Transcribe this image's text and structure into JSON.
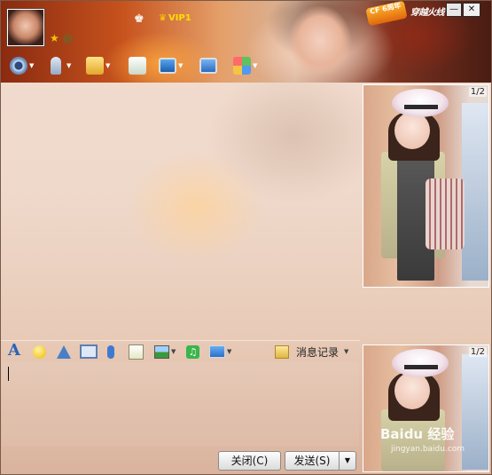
{
  "header": {
    "vip_label": "VIP1",
    "skin_badge": "CF 6周年",
    "skin_caption": "穿越火线",
    "minimize_glyph": "—",
    "close_glyph": "✕",
    "icons": [
      "avatar",
      "star-icon",
      "qq-status-icon",
      "penguin-icon",
      "crown-icon"
    ]
  },
  "toolbar": {
    "items": [
      {
        "name": "video-chat-icon",
        "has_menu": true
      },
      {
        "name": "voice-chat-icon",
        "has_menu": true
      },
      {
        "name": "send-file-icon",
        "has_menu": true
      },
      {
        "name": "sms-icon",
        "has_menu": false
      },
      {
        "name": "remote-assist-icon",
        "has_menu": true
      },
      {
        "name": "screen-share-icon",
        "has_menu": false
      },
      {
        "name": "app-center-icon",
        "has_menu": true
      }
    ]
  },
  "show_panel": {
    "top_pager": "1/2",
    "bottom_pager": "1/2"
  },
  "input_toolbar": {
    "font_glyph": "A",
    "music_glyph": "♫",
    "history_label": "消息记录"
  },
  "buttons": {
    "close_label": "关闭(C)",
    "send_label": "发送(S)",
    "send_menu_glyph": "▼"
  },
  "watermark": {
    "brand": "Baidu 经验",
    "url": "jingyan.baidu.com"
  },
  "colors": {
    "accent": "#2a63b8",
    "vip": "#ffdf00",
    "chat_bg": "#efd9cb"
  }
}
